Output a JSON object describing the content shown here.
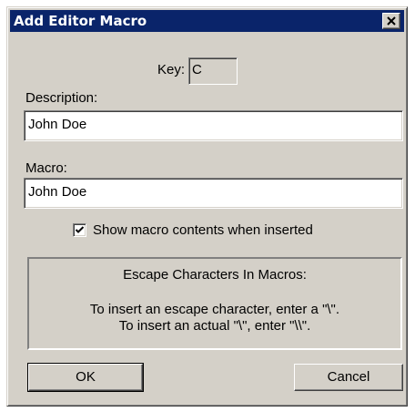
{
  "dialog": {
    "title": "Add Editor Macro"
  },
  "key": {
    "label": "Key:",
    "value": "C"
  },
  "description": {
    "label": "Description:",
    "value": "John Doe"
  },
  "macro": {
    "label": "Macro:",
    "value": "John Doe"
  },
  "option": {
    "label": "Show macro contents when inserted",
    "checked": true
  },
  "escape_info": {
    "title": "Escape Characters In Macros:",
    "line1": "To insert an escape character, enter a \"\\\".",
    "line2": "To insert an actual \"\\\", enter \"\\\\\"."
  },
  "buttons": {
    "ok": "OK",
    "cancel": "Cancel"
  },
  "icons": {
    "close": "close-icon",
    "check": "checkmark-icon"
  },
  "colors": {
    "titlebar": "#0a246a",
    "face": "#d4d0c8",
    "field": "#ffffff"
  }
}
